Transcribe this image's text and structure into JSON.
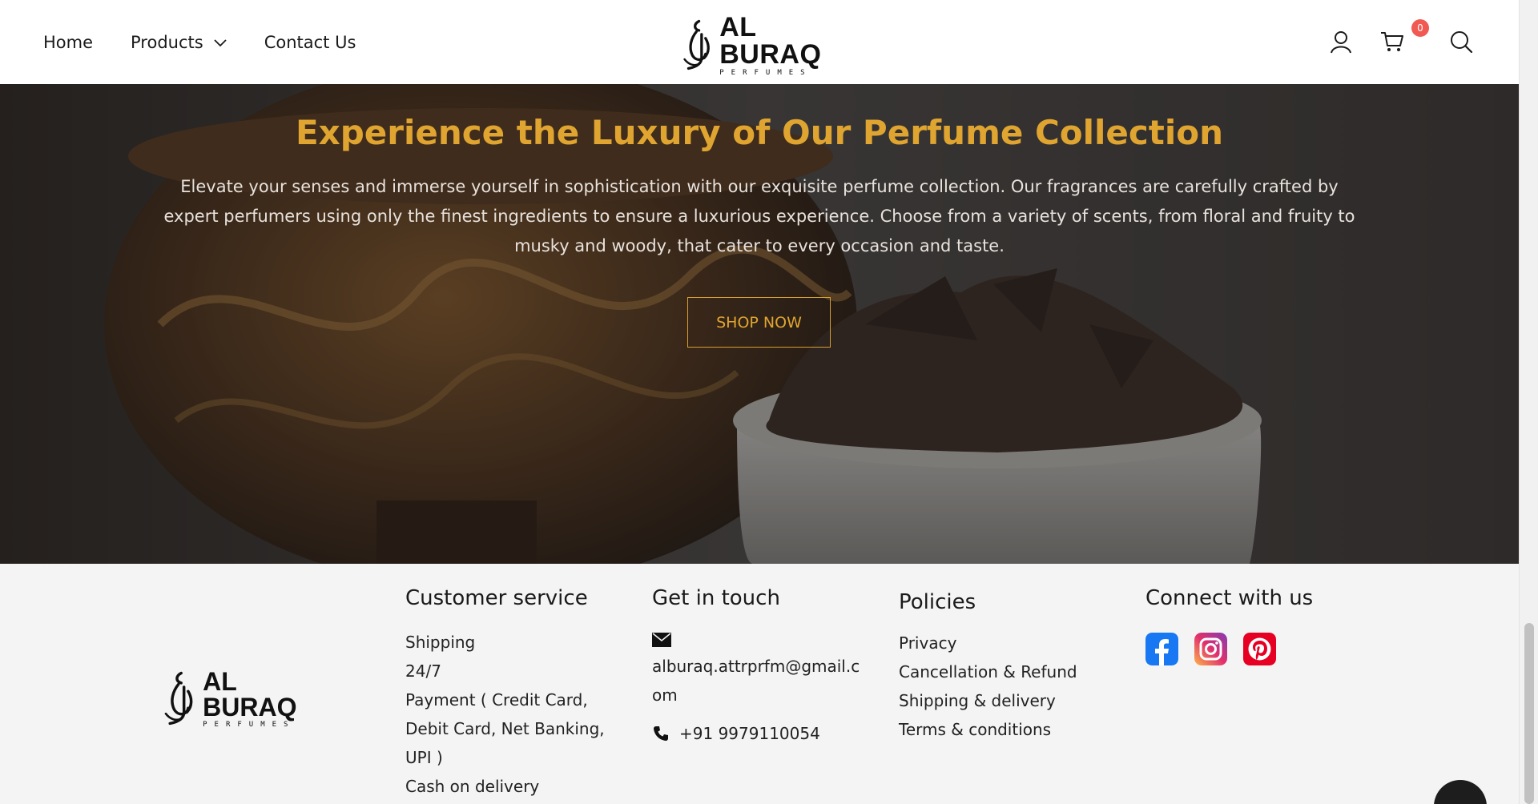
{
  "nav": {
    "home": "Home",
    "products": "Products",
    "contact": "Contact Us"
  },
  "logo": {
    "brand": "AL BURAQ",
    "sub": "PERFUMES"
  },
  "cart": {
    "count": "0"
  },
  "hero": {
    "title": "Experience the Luxury of Our Perfume Collection",
    "text": "Elevate your senses and immerse yourself in sophistication with our exquisite perfume collection. Our fragrances are carefully crafted by expert perfumers using only the finest ingredients to ensure a luxurious experience. Choose from a variety of scents, from floral and fruity to musky and woody, that cater to every occasion and taste.",
    "button": "SHOP NOW"
  },
  "footer": {
    "customer_service": {
      "title": "Customer service",
      "lines": [
        "Shipping",
        "24/7",
        "Payment ( Credit Card,",
        "Debit Card, Net Banking,",
        "UPI )",
        "Cash on delivery"
      ]
    },
    "get_in_touch": {
      "title": "Get in touch",
      "email": "alburaq.attrprfm@gmail.com",
      "phone": "+91 9979110054"
    },
    "policies": {
      "title": "Policies",
      "items": [
        "Privacy",
        "Cancellation & Refund",
        "Shipping & delivery",
        "Terms & conditions"
      ]
    },
    "connect": {
      "title": "Connect with us",
      "icons": [
        "facebook-icon",
        "instagram-icon",
        "pinterest-icon"
      ]
    }
  },
  "colors": {
    "accent": "#e0a530",
    "badge": "#f05a52",
    "facebook": "#1877f2",
    "pinterest": "#e60023"
  }
}
